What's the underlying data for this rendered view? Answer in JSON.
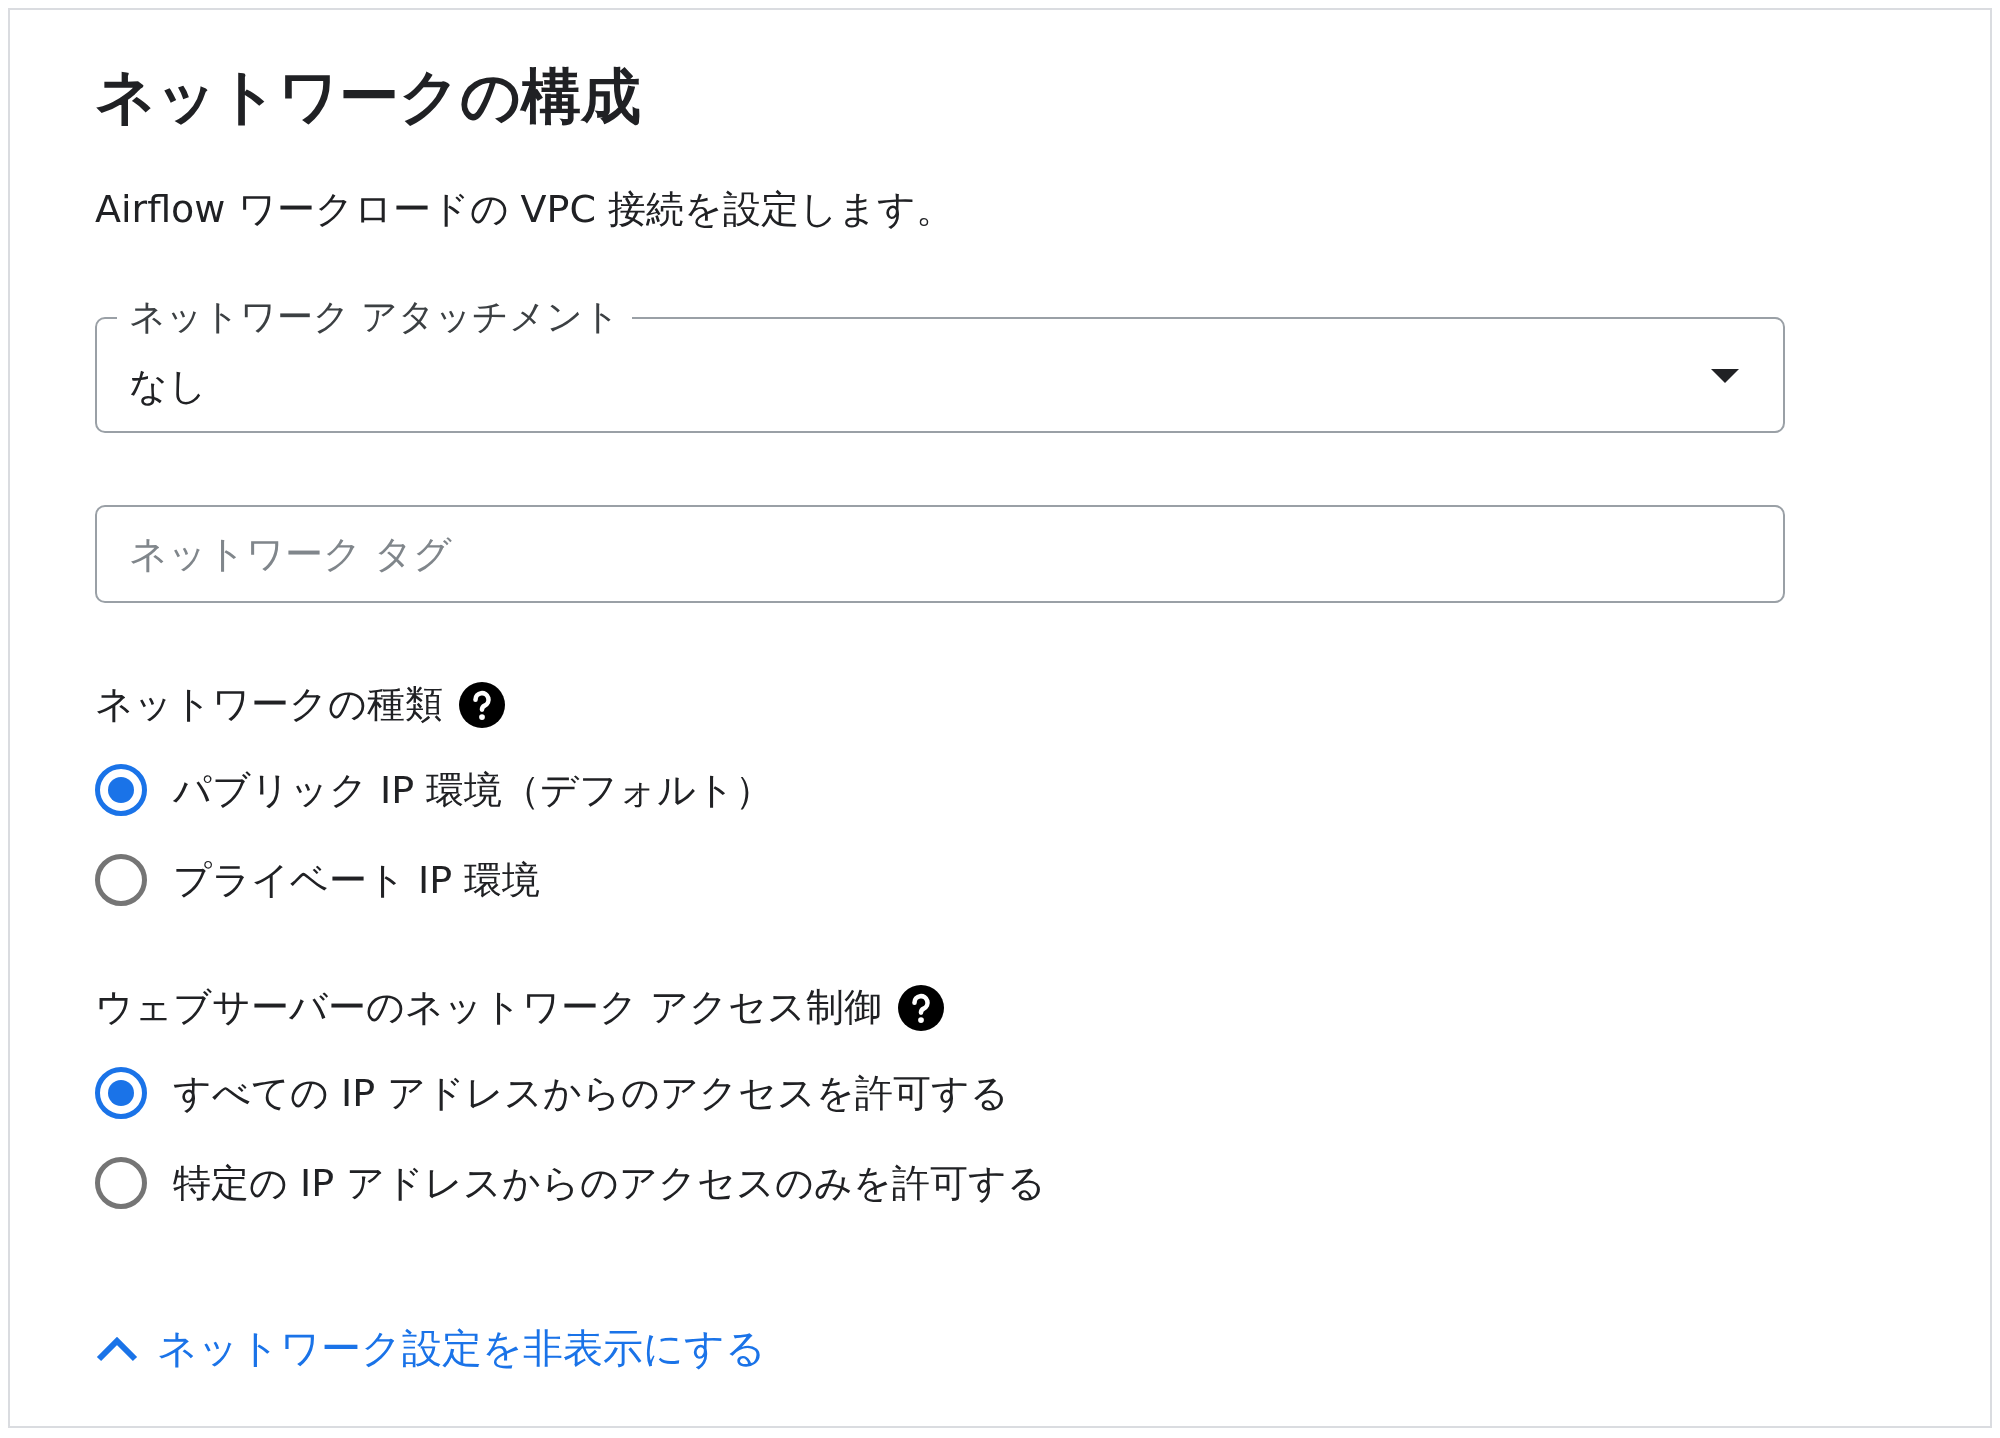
{
  "title": "ネットワークの構成",
  "description": "Airflow ワークロードの VPC 接続を設定します。",
  "network_attachment": {
    "label": "ネットワーク アタッチメント",
    "value": "なし"
  },
  "network_tags": {
    "placeholder": "ネットワーク タグ"
  },
  "network_type": {
    "label": "ネットワークの種類",
    "options": [
      {
        "label": "パブリック IP 環境（デフォルト）",
        "selected": true
      },
      {
        "label": "プライベート IP 環境",
        "selected": false
      }
    ]
  },
  "web_server_access": {
    "label": "ウェブサーバーのネットワーク アクセス制御",
    "options": [
      {
        "label": "すべての IP アドレスからのアクセスを許可する",
        "selected": true
      },
      {
        "label": "特定の IP アドレスからのアクセスのみを許可する",
        "selected": false
      }
    ]
  },
  "toggle_link": {
    "label": "ネットワーク設定を非表示にする",
    "expanded": true
  }
}
